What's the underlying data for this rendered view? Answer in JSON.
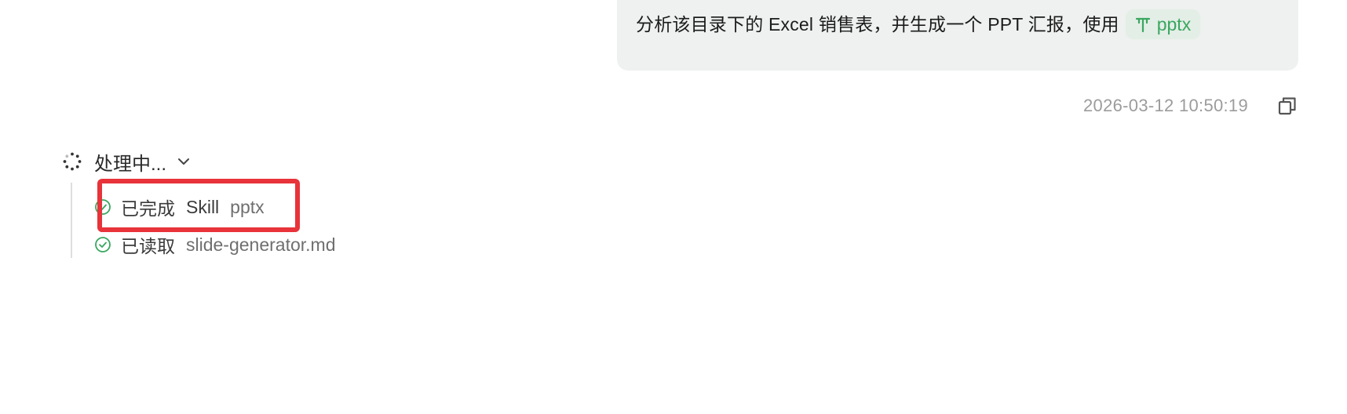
{
  "user_message": {
    "text": "分析该目录下的 Excel 销售表，并生成一个 PPT 汇报，使用",
    "skill_chip": {
      "icon": "skill-icon",
      "label": "pptx"
    }
  },
  "message_meta": {
    "timestamp": "2026-03-12 10:50:19",
    "copy_icon": "copy-icon"
  },
  "processing": {
    "label": "处理中...",
    "spinner_icon": "spinner-icon",
    "chevron_icon": "chevron-down-icon",
    "steps": [
      {
        "status": "已完成",
        "type": "Skill",
        "detail": "pptx",
        "icon": "check-circle-icon"
      },
      {
        "status": "已读取",
        "detail": "slide-generator.md",
        "icon": "check-circle-icon"
      }
    ]
  },
  "colors": {
    "bubble_bg": "#eef1ef",
    "chip_bg": "#e3eee6",
    "accent_green": "#3aa760",
    "highlight_red": "#e8333a"
  }
}
